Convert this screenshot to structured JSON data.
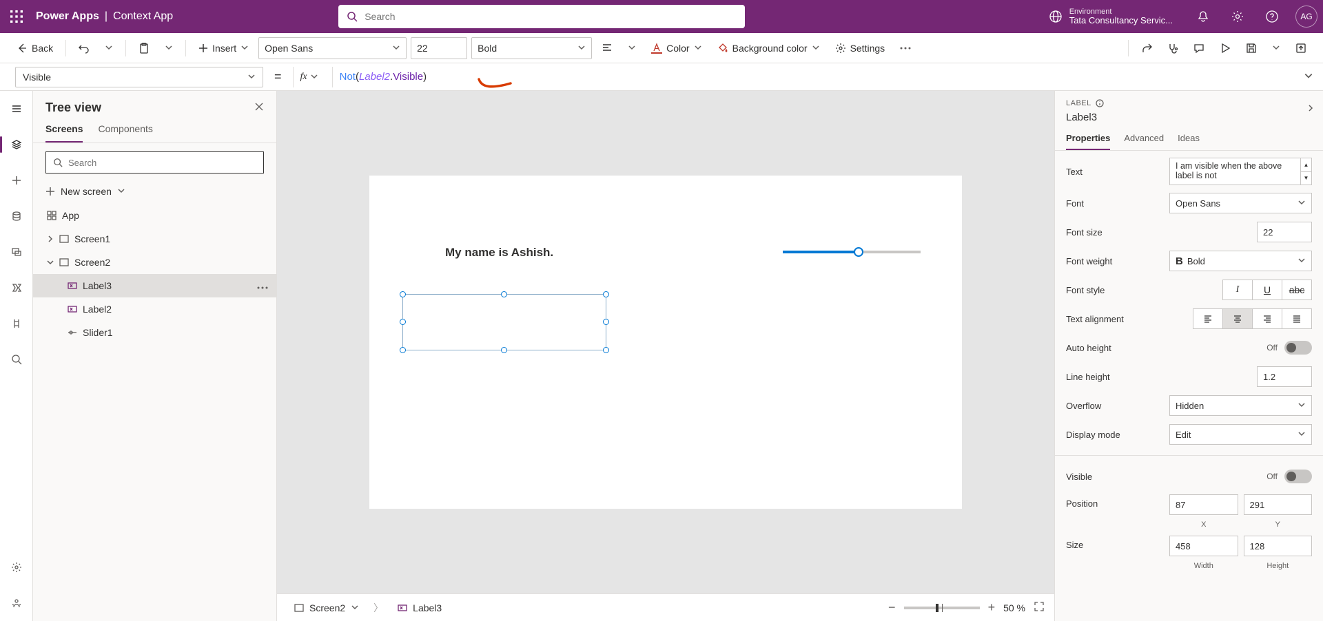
{
  "header": {
    "product": "Power Apps",
    "separator": "|",
    "app_name": "Context App",
    "search_placeholder": "Search",
    "env_label": "Environment",
    "env_value": "Tata Consultancy Servic...",
    "avatar": "AG"
  },
  "cmdbar": {
    "back": "Back",
    "insert": "Insert",
    "font": "Open Sans",
    "font_size": "22",
    "font_weight": "Bold",
    "color": "Color",
    "bgcolor": "Background color",
    "settings": "Settings"
  },
  "formula": {
    "property": "Visible",
    "fx": "fx",
    "tok_func": "Not",
    "tok_open": "(",
    "tok_ref": "Label2",
    "tok_dot": ".",
    "tok_prop": "Visible",
    "tok_close": ")"
  },
  "tree": {
    "title": "Tree view",
    "tab_screens": "Screens",
    "tab_components": "Components",
    "search_placeholder": "Search",
    "new_screen": "New screen",
    "app": "App",
    "screen1": "Screen1",
    "screen2": "Screen2",
    "label3": "Label3",
    "label2": "Label2",
    "slider1": "Slider1"
  },
  "canvas": {
    "label2_text": "My name is Ashish.",
    "crumb_screen": "Screen2",
    "crumb_control": "Label3",
    "zoom_pct": "50 %"
  },
  "props": {
    "kind": "LABEL",
    "name": "Label3",
    "tab_properties": "Properties",
    "tab_advanced": "Advanced",
    "tab_ideas": "Ideas",
    "text_label": "Text",
    "text_value": "I am visible when the above label is not",
    "font_label": "Font",
    "font_value": "Open Sans",
    "fontsize_label": "Font size",
    "fontsize_value": "22",
    "fontweight_label": "Font weight",
    "fontweight_b": "B",
    "fontweight_value": "Bold",
    "fontstyle_label": "Font style",
    "align_label": "Text alignment",
    "autoheight_label": "Auto height",
    "autoheight_state": "Off",
    "lineheight_label": "Line height",
    "lineheight_value": "1.2",
    "overflow_label": "Overflow",
    "overflow_value": "Hidden",
    "displaymode_label": "Display mode",
    "displaymode_value": "Edit",
    "visible_label": "Visible",
    "visible_state": "Off",
    "position_label": "Position",
    "pos_x": "87",
    "pos_y": "291",
    "pos_xl": "X",
    "pos_yl": "Y",
    "size_label": "Size",
    "size_w": "458",
    "size_h": "128",
    "size_wl": "Width",
    "size_hl": "Height"
  }
}
